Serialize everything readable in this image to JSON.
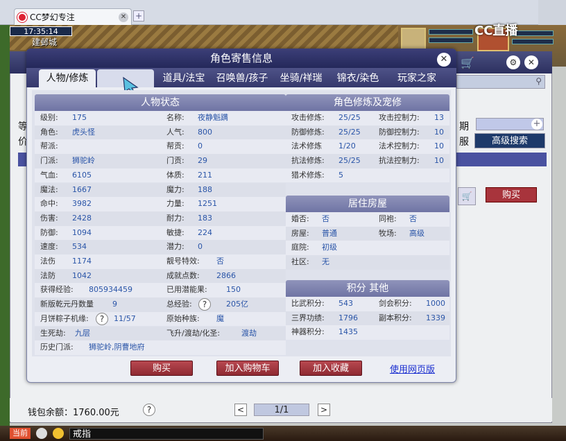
{
  "browser": {
    "tab_title": "CC梦幻专注",
    "new_tab": "+"
  },
  "game": {
    "clock": "17:35:14",
    "city": "建邺城",
    "stream_logo": "CC直播"
  },
  "market": {
    "date_label": "期",
    "server_label": "服",
    "advanced_search": "高级搜索",
    "buy": "购买",
    "left_frag1": "等",
    "left_frag2": "价"
  },
  "footer": {
    "wallet": "钱包余额：1760.00元",
    "help": "?",
    "prev": "<",
    "page": "1/1",
    "next": ">"
  },
  "taskbar": {
    "now": "当前",
    "input": "戒指"
  },
  "dialog": {
    "title": "角色寄售信息",
    "tabs": [
      "人物/修炼",
      "道具/法宝",
      "召唤兽/孩子",
      "坐骑/祥瑞",
      "锦衣/染色",
      "玩家之家"
    ],
    "section_status": "人物状态",
    "section_cultivation": "角色修炼及宠修",
    "section_house": "居住房屋",
    "section_points": "积分 其他",
    "status_left": [
      {
        "label": "级别:",
        "value": "175"
      },
      {
        "label": "角色:",
        "value": "虎头怪"
      },
      {
        "label": "帮派:",
        "value": ""
      },
      {
        "label": "门派:",
        "value": "狮驼岭"
      },
      {
        "label": "气血:",
        "value": "6105"
      },
      {
        "label": "魔法:",
        "value": "1667"
      },
      {
        "label": "命中:",
        "value": "3982"
      },
      {
        "label": "伤害:",
        "value": "2428"
      },
      {
        "label": "防御:",
        "value": "1094"
      },
      {
        "label": "速度:",
        "value": "534"
      },
      {
        "label": "法伤",
        "value": "1174"
      },
      {
        "label": "法防",
        "value": "1042"
      }
    ],
    "status_right": [
      {
        "label": "名称:",
        "value": "夜静魁蹒"
      },
      {
        "label": "人气:",
        "value": "800"
      },
      {
        "label": "帮贡:",
        "value": "0"
      },
      {
        "label": "门贡:",
        "value": "29"
      },
      {
        "label": "体质:",
        "value": "211"
      },
      {
        "label": "魔力:",
        "value": "188"
      },
      {
        "label": "力量:",
        "value": "1251"
      },
      {
        "label": "耐力:",
        "value": "183"
      },
      {
        "label": "敏捷:",
        "value": "224"
      },
      {
        "label": "潜力:",
        "value": "0"
      },
      {
        "label": "靓号特效:",
        "value": "否"
      },
      {
        "label": "成就点数:",
        "value": "2866"
      }
    ],
    "extra_rows": [
      {
        "l1": "获得经验:",
        "v1": "805934459",
        "l2": "已用潜能果:",
        "v2": "150"
      },
      {
        "l1": "新版乾元丹数量",
        "v1": "9",
        "l2": "总经验:",
        "v2": "205亿",
        "q2": "?"
      },
      {
        "l1": "月饼粽子机缘:",
        "v1": "11/57",
        "q1": "?",
        "l2": "原始种族:",
        "v2": "魔"
      },
      {
        "l1": "生死劫:",
        "v1": "九层",
        "l2": "飞升/渡劫/化圣:",
        "v2": "渡劫"
      },
      {
        "l1": "历史门派:",
        "v1": "狮驼岭,阴曹地府",
        "l2": "",
        "v2": ""
      }
    ],
    "cultivation": [
      {
        "l1": "攻击修炼:",
        "v1": "25/25",
        "l2": "攻击控制力:",
        "v2": "13"
      },
      {
        "l1": "防御修炼:",
        "v1": "25/25",
        "l2": "防御控制力:",
        "v2": "10"
      },
      {
        "l1": "法术修炼",
        "v1": "1/20",
        "l2": "法术控制力:",
        "v2": "10"
      },
      {
        "l1": "抗法修炼:",
        "v1": "25/25",
        "l2": "抗法控制力:",
        "v2": "10"
      },
      {
        "l1": "猎术修炼:",
        "v1": "5",
        "l2": "",
        "v2": ""
      }
    ],
    "house": [
      {
        "l1": "婚否:",
        "v1": "否",
        "l2": "同袍:",
        "v2": "否"
      },
      {
        "l1": "房屋:",
        "v1": "普通",
        "l2": "牧场:",
        "v2": "高级"
      },
      {
        "l1": "庭院:",
        "v1": "初级",
        "l2": "",
        "v2": ""
      },
      {
        "l1": "社区:",
        "v1": "无",
        "l2": "",
        "v2": ""
      }
    ],
    "points": [
      {
        "l1": "比武积分:",
        "v1": "543",
        "l2": "剑会积分:",
        "v2": "1000"
      },
      {
        "l1": "三界功绩:",
        "v1": "1796",
        "l2": "副本积分:",
        "v2": "1339"
      },
      {
        "l1": "神器积分:",
        "v1": "1435",
        "l2": "",
        "v2": ""
      }
    ],
    "buttons": {
      "buy": "购买",
      "add_cart": "加入购物车",
      "add_fav": "加入收藏",
      "web": "使用网页版"
    }
  },
  "colors": {
    "title_bar": "#24285a",
    "section_head": "#7b80ac",
    "value_blue": "#2a55a8",
    "button_red": "#a8343c"
  }
}
